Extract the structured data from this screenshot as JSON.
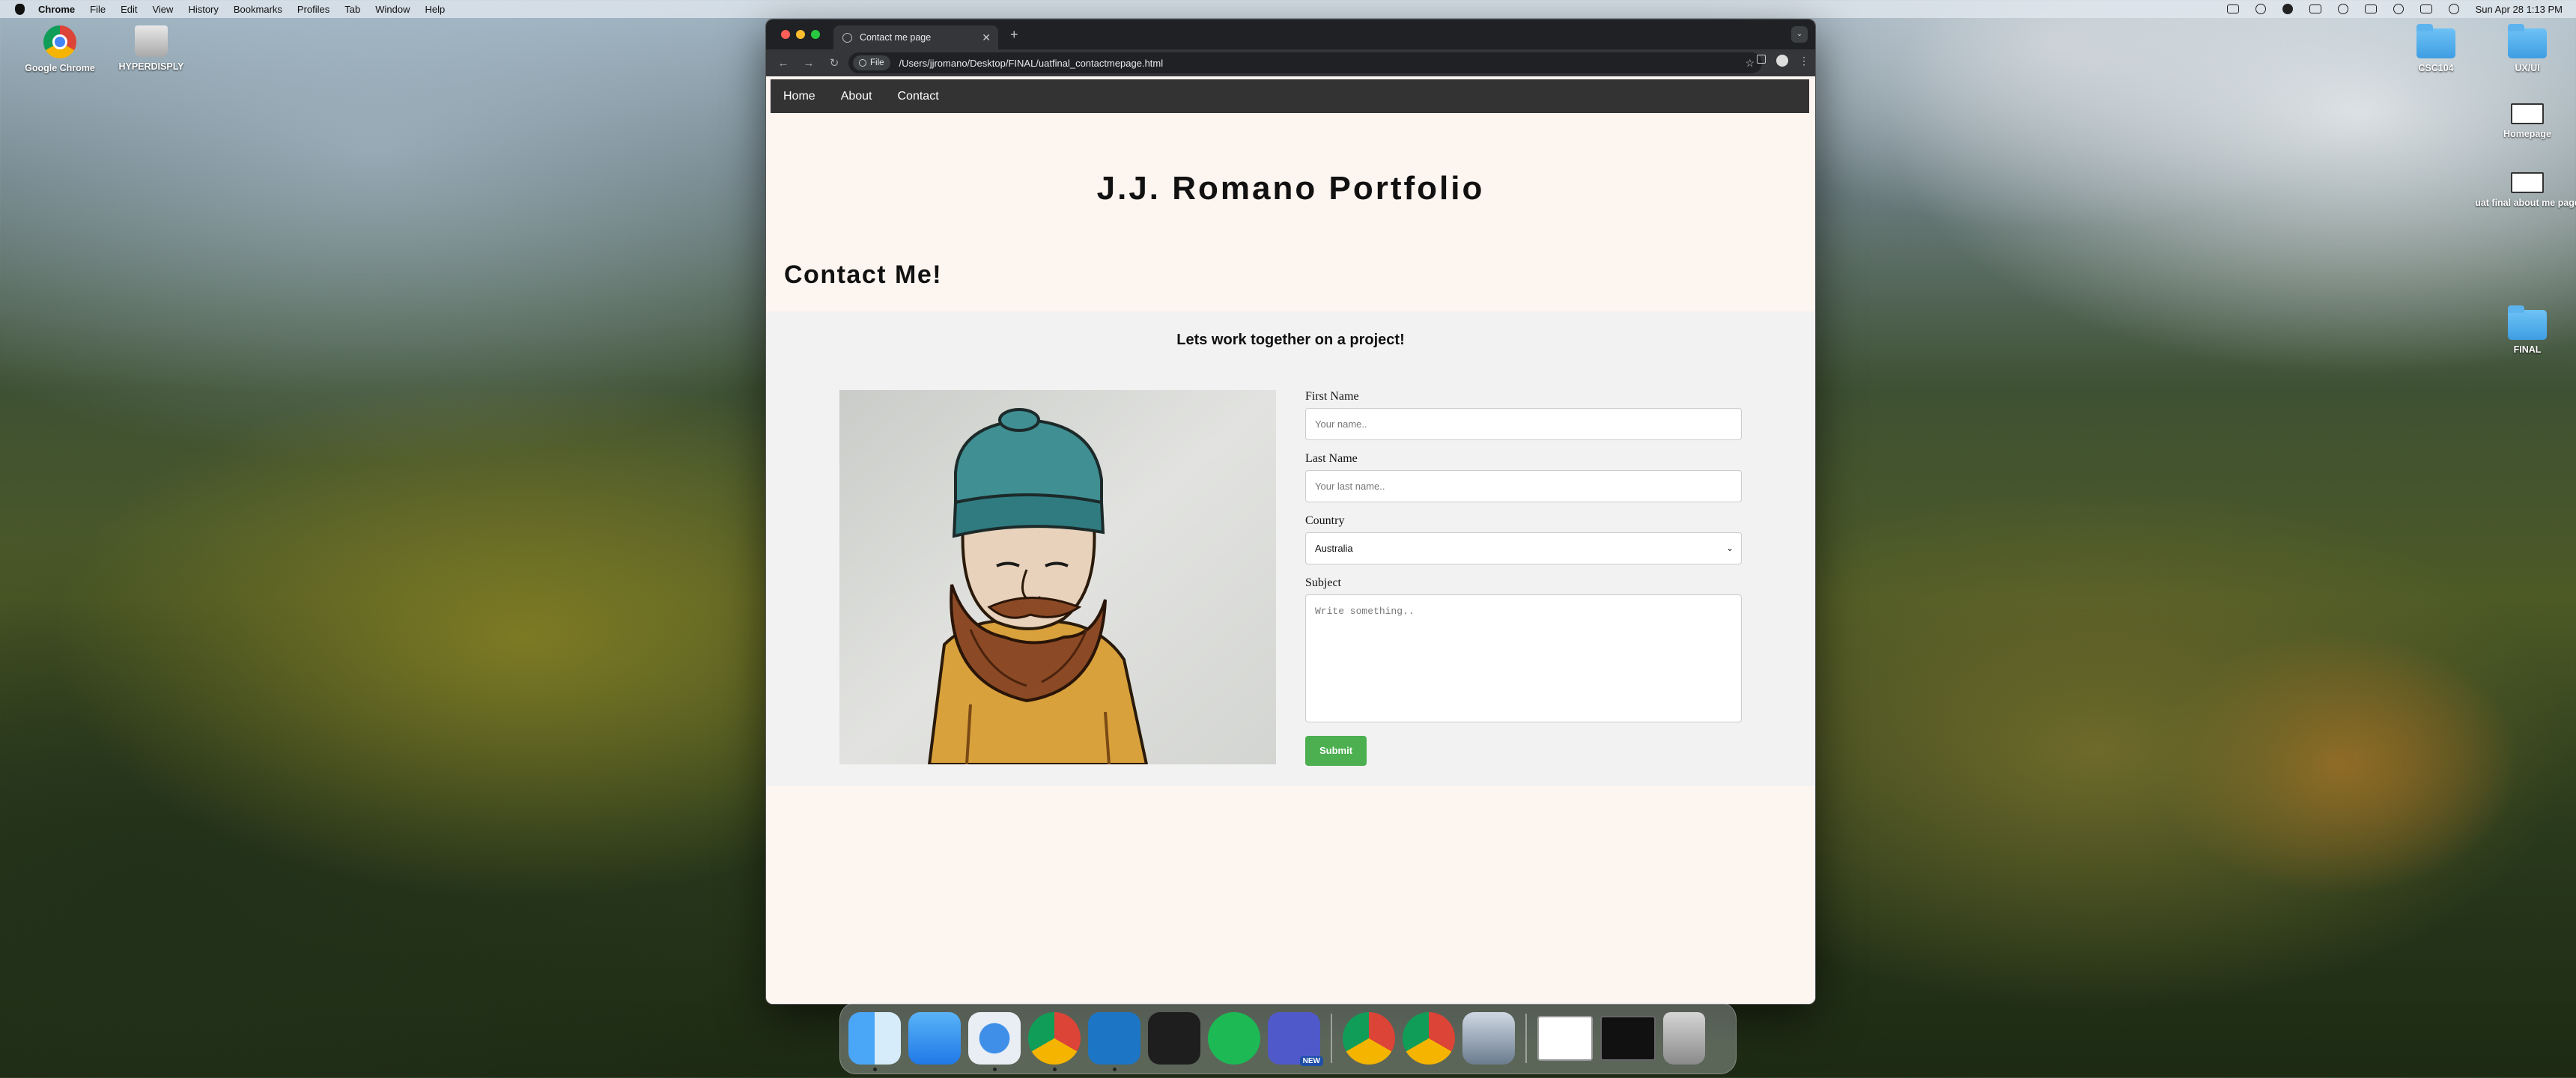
{
  "menubar": {
    "app_name": "Chrome",
    "items": [
      "File",
      "Edit",
      "View",
      "History",
      "Bookmarks",
      "Profiles",
      "Tab",
      "Window",
      "Help"
    ],
    "datetime": "Sun Apr 28  1:13 PM"
  },
  "desktop": {
    "left_icons": [
      {
        "label": "Google Chrome",
        "icon": "chrome-icon"
      },
      {
        "label": "HYPERDISPLY",
        "icon": "drive-icon"
      }
    ],
    "right_icons": [
      {
        "label": "CSC104",
        "icon": "folder-icon"
      },
      {
        "label": "UX/UI",
        "icon": "folder-icon"
      },
      {
        "label": "Homepage",
        "icon": "html-file-icon"
      },
      {
        "label": "uat final about me page",
        "icon": "html-file-icon"
      },
      {
        "label": "FINAL",
        "icon": "folder-icon"
      }
    ]
  },
  "browser": {
    "tab_title": "Contact me page",
    "url_chip": "File",
    "url": "/Users/jjromano/Desktop/FINAL/uatfinal_contactmepage.html"
  },
  "page": {
    "nav": [
      "Home",
      "About",
      "Contact"
    ],
    "site_title": "J.J. Romano Portfolio",
    "section_heading": "Contact Me!",
    "tagline": "Lets work together on a project!",
    "form": {
      "first_name_label": "First Name",
      "first_name_placeholder": "Your name..",
      "last_name_label": "Last Name",
      "last_name_placeholder": "Your last name..",
      "country_label": "Country",
      "country_value": "Australia",
      "subject_label": "Subject",
      "subject_placeholder": "Write something..",
      "submit_label": "Submit"
    }
  },
  "dock": {
    "apps": [
      "finder",
      "mail",
      "safari",
      "chrome",
      "vscode",
      "figma",
      "spotify",
      "teams",
      "chrome",
      "chrome",
      "preview",
      "window-thumbnail",
      "window-thumbnail",
      "trash"
    ],
    "teams_badge": "NEW"
  },
  "colors": {
    "page_bg": "#fdf5f0",
    "nav_bg": "#333333",
    "band_bg": "#f2f2f2",
    "submit_bg": "#4caf50"
  }
}
